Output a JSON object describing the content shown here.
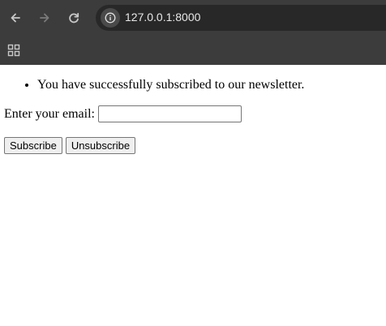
{
  "browser": {
    "url": "127.0.0.1:8000",
    "icons": {
      "back": "arrow-left",
      "forward": "arrow-right",
      "reload": "refresh",
      "site_info": "info-circle",
      "apps": "grid"
    }
  },
  "page": {
    "messages": [
      "You have successfully subscribed to our newsletter."
    ],
    "email_label": "Enter your email:",
    "email_value": "",
    "subscribe_label": "Subscribe",
    "unsubscribe_label": "Unsubscribe"
  }
}
